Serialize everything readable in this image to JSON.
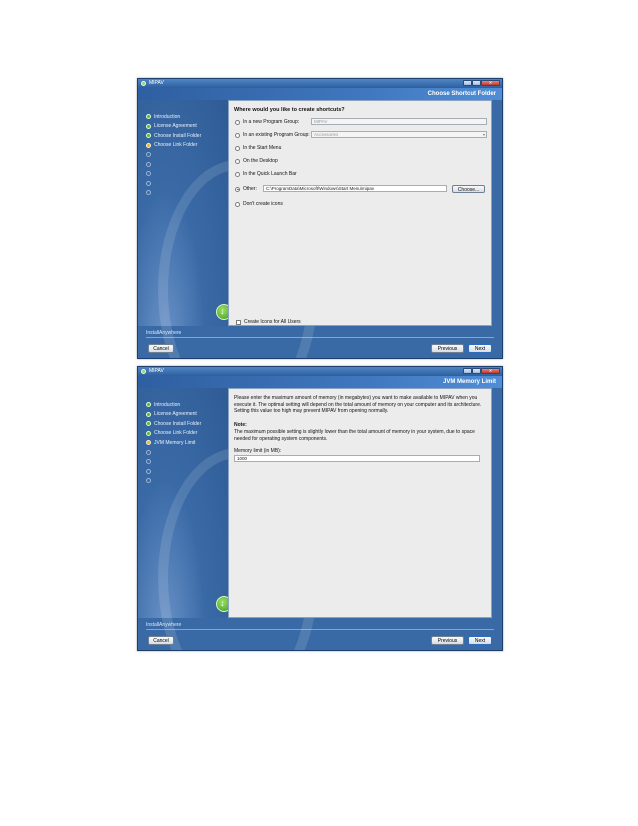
{
  "windows": [
    {
      "title": "MIPAV",
      "header": "Choose Shortcut Folder",
      "steps": [
        {
          "label": "Introduction",
          "state": "done"
        },
        {
          "label": "License Agreement",
          "state": "done"
        },
        {
          "label": "Choose Install Folder",
          "state": "done"
        },
        {
          "label": "Choose Link Folder",
          "state": "current"
        },
        {
          "label": "",
          "state": "pending"
        },
        {
          "label": "",
          "state": "pending"
        },
        {
          "label": "",
          "state": "pending"
        },
        {
          "label": "",
          "state": "pending"
        },
        {
          "label": "",
          "state": "pending"
        }
      ],
      "question": "Where would you like to create shortcuts?",
      "options": [
        {
          "label": "In a new Program Group:",
          "field": "MIPAV"
        },
        {
          "label": "In an existing Program Group:",
          "field": "Accessories"
        },
        {
          "label": "In the Start Menu"
        },
        {
          "label": "On the Desktop"
        },
        {
          "label": "In the Quick Launch Bar"
        },
        {
          "label": "Other:",
          "field": "C:\\ProgramData\\Microsoft\\Windows\\Start Menu\\mipav",
          "selected": true
        },
        {
          "label": "Don't create icons"
        }
      ],
      "choose_label": "Choose...",
      "all_users_label": "Create Icons for All Users",
      "footer_label": "InstallAnywhere",
      "cancel_label": "Cancel",
      "previous_label": "Previous",
      "next_label": "Next"
    },
    {
      "title": "MIPAV",
      "header": "JVM Memory Limit",
      "steps": [
        {
          "label": "Introduction",
          "state": "done"
        },
        {
          "label": "License Agreement",
          "state": "done"
        },
        {
          "label": "Choose Install Folder",
          "state": "done"
        },
        {
          "label": "Choose Link Folder",
          "state": "done"
        },
        {
          "label": "JVM Memory Limit",
          "state": "current"
        },
        {
          "label": "",
          "state": "pending"
        },
        {
          "label": "",
          "state": "pending"
        },
        {
          "label": "",
          "state": "pending"
        },
        {
          "label": "",
          "state": "pending"
        }
      ],
      "intro_text": "Please enter the maximum amount of memory (in megabytes) you want to make available to MIPAV when you execute it. The optimal setting will depend on the total amount of memory on your computer and its architecture. Setting this value too high may prevent MIPAV from opening normally.",
      "note_label": "Note:",
      "note_text": "The maximum possible setting is slightly lower than the total amount of memory in your system, due to space needed for operating system components.",
      "memory_label": "Memory limit (in MB):",
      "memory_value": "1000",
      "footer_label": "InstallAnywhere",
      "cancel_label": "Cancel",
      "previous_label": "Previous",
      "next_label": "Next"
    }
  ]
}
